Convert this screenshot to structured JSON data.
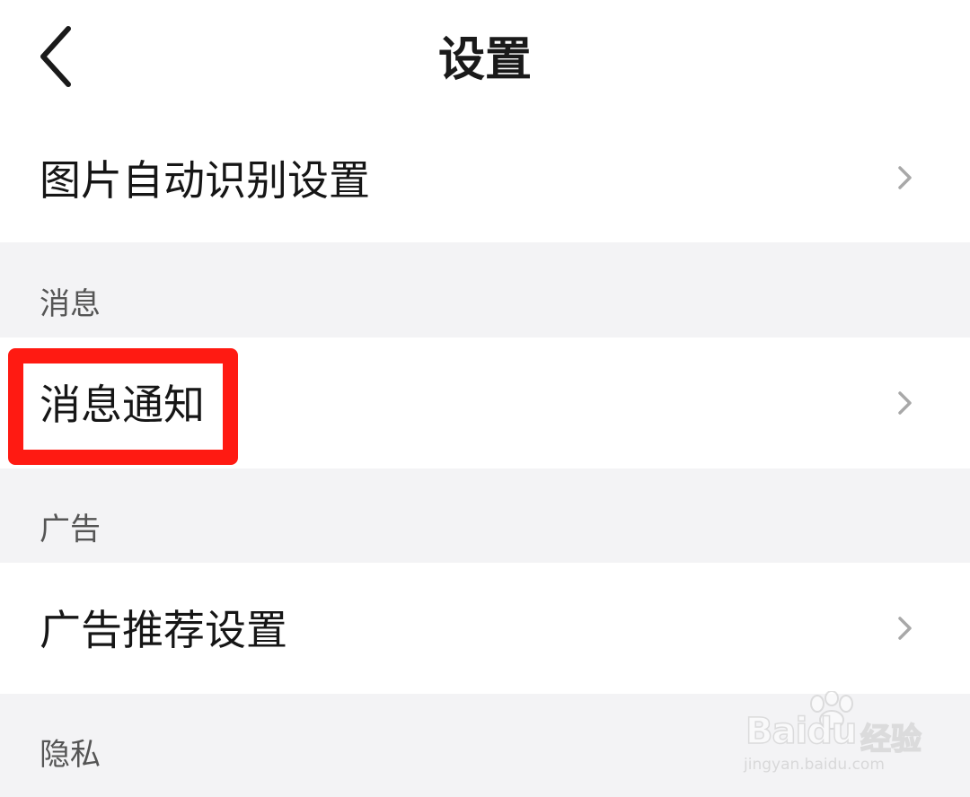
{
  "header": {
    "title": "设置",
    "back_icon": "chevron-left-icon"
  },
  "settings": {
    "image_recognition": {
      "label": "图片自动识别设置",
      "icon": "chevron-right-icon"
    },
    "messages_section": {
      "header": "消息",
      "notifications": {
        "label": "消息通知",
        "icon": "chevron-right-icon"
      }
    },
    "ads_section": {
      "header": "广告",
      "ad_recommend": {
        "label": "广告推荐设置",
        "icon": "chevron-right-icon"
      }
    },
    "privacy_section": {
      "header": "隐私"
    }
  },
  "highlight": {
    "color": "#ff1a12"
  },
  "watermark": {
    "brand": "Baidu",
    "suffix": "经验",
    "url": "jingyan.baidu.com"
  },
  "colors": {
    "page_background": "#f3f3f5",
    "row_background": "#ffffff",
    "chevron": "#a8a8a8"
  }
}
